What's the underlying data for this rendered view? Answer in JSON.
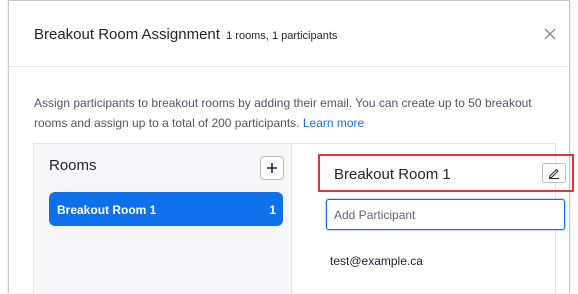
{
  "dialog": {
    "title": "Breakout Room Assignment",
    "subtitle": "1 rooms, 1 participants",
    "close_icon": "close-icon"
  },
  "description": {
    "text": "Assign participants to breakout rooms by adding their email. You can create up to 50 breakout rooms and assign up to a total of 200 participants.",
    "link_text": "Learn more"
  },
  "rooms": {
    "heading": "Rooms",
    "add_icon": "plus-icon",
    "items": [
      {
        "name": "Breakout Room 1",
        "count": "1",
        "selected": true
      }
    ]
  },
  "room_detail": {
    "name": "Breakout Room 1",
    "rename_icon": "pencil-icon",
    "input_placeholder": "Add Participant",
    "participants": [
      "test@example.ca"
    ]
  },
  "colors": {
    "accent": "#0e71eb",
    "highlight_border": "#e0353f"
  }
}
